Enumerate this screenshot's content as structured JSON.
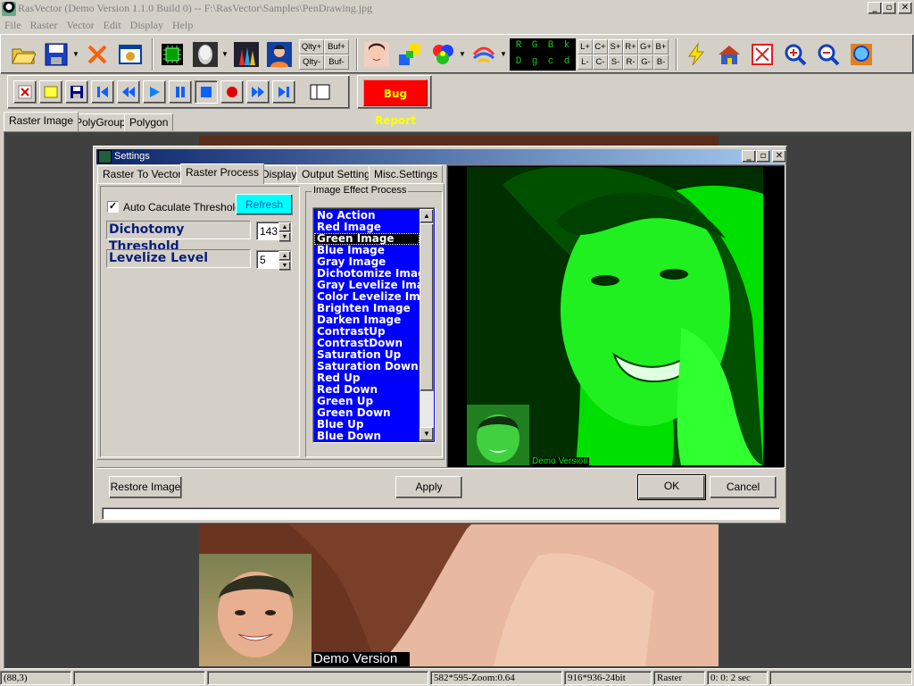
{
  "app": {
    "title": "RasVector (Demo Version 1.1.0 Build 0) -- F:\\RasVector\\Samples\\PenDrawing.jpg",
    "window_buttons": [
      "_",
      "▫",
      "✕"
    ]
  },
  "menu": {
    "items": [
      "File",
      "Raster",
      "Vector",
      "Edit",
      "Display",
      "Help"
    ]
  },
  "toolbar1": {
    "icons": [
      "open-folder-icon",
      "save-disk-icon",
      "delete-x-icon",
      "window-icon",
      "chip-icon",
      "face-3d-icon",
      "brushes-icon",
      "portrait-icon"
    ],
    "qlty": [
      "Qlty+",
      "Buf+",
      "Qlty-",
      "Buf-"
    ],
    "icons2": [
      "face-photo-icon",
      "shapes-icon",
      "color-balls-icon",
      "paint-brush-icon"
    ],
    "rgb": [
      "R",
      "G",
      "B",
      "k",
      "D",
      "g",
      "c",
      "d"
    ],
    "adjust": [
      "L+",
      "C+",
      "S+",
      "R+",
      "G+",
      "B+",
      "L-",
      "C-",
      "S-",
      "R-",
      "G-",
      "B-"
    ],
    "icons3": [
      "lightning-icon",
      "house-icon",
      "fullscreen-icon",
      "zoom-in-icon",
      "zoom-out-icon",
      "zoom-fit-icon"
    ]
  },
  "toolbar2": {
    "buttons": [
      "stop-red-icon",
      "new-yellow-icon",
      "save-small-icon",
      "first-icon",
      "rewind-icon",
      "play-icon",
      "pause-icon",
      "stop-square-icon",
      "record-icon",
      "forward-icon",
      "last-icon"
    ],
    "bug_report": "Bug Report"
  },
  "doc_tabs": [
    "Raster Image",
    "PolyGroup",
    "Polygon"
  ],
  "settings": {
    "title": "Settings",
    "tabs": [
      "Raster To Vector",
      "Raster Process",
      "Display",
      "Output Setting",
      "Misc.Settings"
    ],
    "active_tab": "Raster Process",
    "auto_threshold_label": "Auto Caculate Threshold",
    "auto_threshold_checked": true,
    "refresh_label": "Refresh",
    "dichotomy_label": "Dichotomy Threshold",
    "dichotomy_value": "143",
    "levelize_label": "Levelize Level",
    "levelize_value": "5",
    "effect_group_label": "Image Effect Process",
    "effects": [
      "No Action",
      "Red Image",
      "Green Image",
      "Blue Image",
      "Gray Image",
      "Dichotomize Image",
      "Gray Levelize Image",
      "Color Levelize Image",
      "Brighten Image",
      "Darken Image",
      "ContrastUp",
      "ContrastDown",
      "Saturation Up",
      "Saturation Down",
      "Red Up",
      "Red Down",
      "Green Up",
      "Green Down",
      "Blue Up",
      "Blue Down"
    ],
    "selected_effect": "Green Image",
    "preview_watermark": "Demo Version",
    "restore_label": "Restore Image",
    "apply_label": "Apply",
    "ok_label": "OK",
    "cancel_label": "Cancel"
  },
  "canvas": {
    "watermark": "Demo Version"
  },
  "statusbar": {
    "coords": "(88,3)",
    "zoom_info": "582*595-Zoom:0.64",
    "image_info": "916*936-24bit",
    "mode": "Raster",
    "time": "0: 0: 2 sec"
  },
  "colors": {
    "preview_green": "#00ff00",
    "list_bg": "#0000ff",
    "bug_report_bg": "#ff0000",
    "bug_report_text": "#ffff00",
    "refresh_bg": "#00ffff"
  }
}
